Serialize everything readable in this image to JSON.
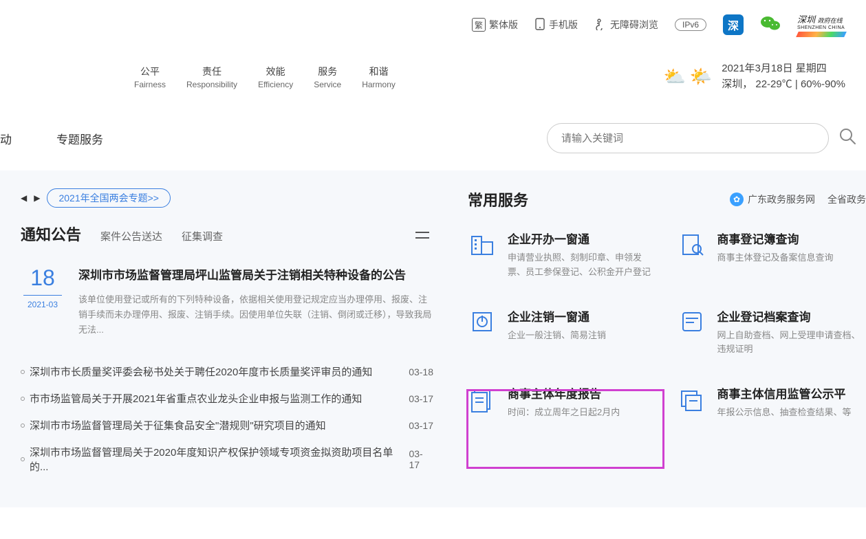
{
  "top_bar": {
    "traditional": "繁体版",
    "mobile": "手机版",
    "accessibility": "无障碍浏览",
    "ipv6": "IPv6",
    "brand_text": "SHENZHEN CHINA"
  },
  "mottos": [
    {
      "cn": "公平",
      "en": "Fairness"
    },
    {
      "cn": "责任",
      "en": "Responsibility"
    },
    {
      "cn": "效能",
      "en": "Efficiency"
    },
    {
      "cn": "服务",
      "en": "Service"
    },
    {
      "cn": "和谐",
      "en": "Harmony"
    }
  ],
  "weather": {
    "date": "2021年3月18日 星期四",
    "detail": "深圳， 22-29℃   |   60%-90%"
  },
  "nav": {
    "item1": "动",
    "item2": "专题服务"
  },
  "search": {
    "placeholder": "请输入关键词"
  },
  "banner": {
    "label": "2021年全国两会专题>>"
  },
  "left_tabs": {
    "main": "通知公告",
    "sub1": "案件公告送达",
    "sub2": "征集调查"
  },
  "featured": {
    "day": "18",
    "ym": "2021-03",
    "title": "深圳市市场监督管理局坪山监管局关于注销相关特种设备的公告",
    "desc": "该单位使用登记或所有的下列特种设备，依据相关使用登记规定应当办理停用、报废、注销手续而未办理停用、报废、注销手续。因使用单位失联（注销、倒闭或迁移），导致我局无法..."
  },
  "news": [
    {
      "title": "深圳市市长质量奖评委会秘书处关于聘任2020年度市长质量奖评审员的通知",
      "date": "03-18"
    },
    {
      "title": "市市场监管局关于开展2021年省重点农业龙头企业申报与监测工作的通知",
      "date": "03-17"
    },
    {
      "title": "深圳市市场监督管理局关于征集食品安全\"潜规则\"研究项目的通知",
      "date": "03-17"
    },
    {
      "title": "深圳市市场监督管理局关于2020年度知识产权保护领域专项资金拟资助项目名单的...",
      "date": "03-17"
    }
  ],
  "svc_header": {
    "title": "常用服务",
    "link1": "广东政务服务网",
    "link2": "全省政务"
  },
  "services": [
    {
      "name": "企业开办一窗通",
      "desc": "申请营业执照、刻制印章、申领发票、员工参保登记、公积金开户登记"
    },
    {
      "name": "商事登记簿查询",
      "desc": "商事主体登记及备案信息查询"
    },
    {
      "name": "企业注销一窗通",
      "desc": "企业一般注销、简易注销"
    },
    {
      "name": "企业登记档案查询",
      "desc": "网上自助查档、网上受理申请查档、违规证明"
    },
    {
      "name": "商事主体年度报告",
      "desc": "时间：成立周年之日起2月内"
    },
    {
      "name": "商事主体信用监管公示平",
      "desc": "年报公示信息、抽查检查结果、等"
    }
  ]
}
